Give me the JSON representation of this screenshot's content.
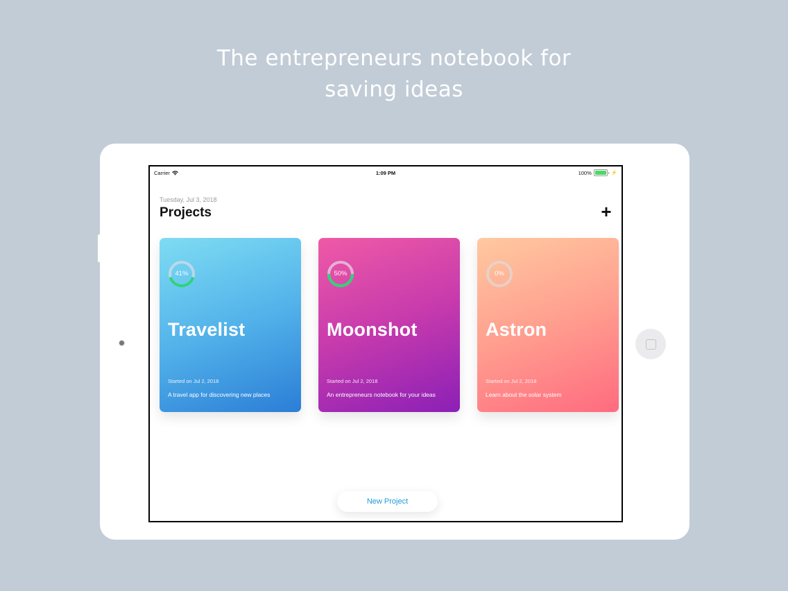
{
  "headline": {
    "line1": "The entrepreneurs notebook for",
    "line2": "saving ideas"
  },
  "statusbar": {
    "carrier": "Carrier",
    "time": "1:09 PM",
    "battery": "100%",
    "wifi_icon": "wifi-icon",
    "battery_icon": "battery-icon"
  },
  "header": {
    "date": "Tuesday, Jul 3, 2018",
    "title": "Projects",
    "add_label": "+"
  },
  "projects": [
    {
      "name": "Travelist",
      "progress_label": "41%",
      "progress": 0.41,
      "started": "Started on Jul 2, 2018",
      "description": "A travel app for discovering new places",
      "gradient": [
        "#7fdcf3",
        "#2b7ed6"
      ]
    },
    {
      "name": "Moonshot",
      "progress_label": "50%",
      "progress": 0.5,
      "started": "Started on Jul 2, 2018",
      "description": "An entrepreneurs notebook for your ideas",
      "gradient": [
        "#ef5aa6",
        "#8b20b6"
      ]
    },
    {
      "name": "Astron",
      "progress_label": "0%",
      "progress": 0,
      "started": "Started on Jul 2, 2018",
      "description": "Learn about the solar system",
      "gradient": [
        "#ffc9a0",
        "#ff6b7f"
      ]
    }
  ],
  "footer": {
    "new_project_label": "New Project"
  },
  "colors": {
    "background": "#c2ccd6",
    "progress_ring": "#2ed37a",
    "link": "#1e9bd7"
  }
}
